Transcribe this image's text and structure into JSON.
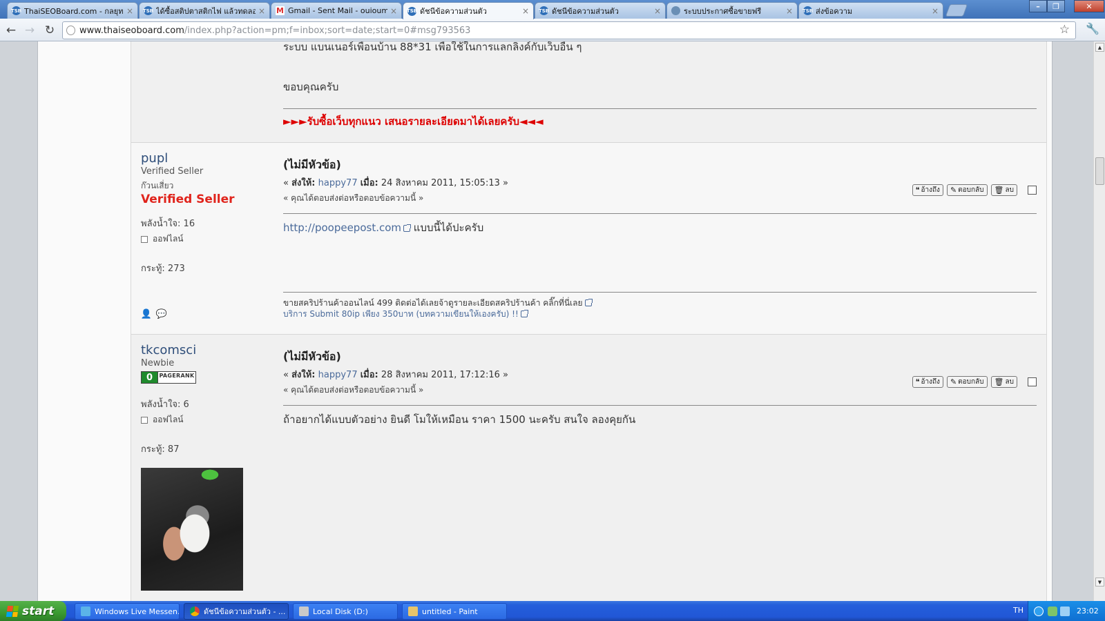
{
  "browser": {
    "tabs": [
      {
        "label": "ThaiSEOBoard.com - กลยุทธ S",
        "icon": "tsb-favicon",
        "active": false
      },
      {
        "label": "ได้ซื้อสติปตาสติกไฟ แล้วทดลอ",
        "icon": "tsb-favicon",
        "active": false
      },
      {
        "label": "Gmail - Sent Mail - ouioum11@",
        "icon": "gmail-favicon",
        "active": false
      },
      {
        "label": "ดัชนีข้อความส่วนตัว",
        "icon": "tsb-favicon",
        "active": true
      },
      {
        "label": "ดัชนีข้อความส่วนตัว",
        "icon": "tsb-favicon",
        "active": false
      },
      {
        "label": "ระบบประกาศซื้อขายฟรี",
        "icon": "globe-favicon",
        "active": false
      },
      {
        "label": "ส่งข้อความ",
        "icon": "tsb-favicon",
        "active": false
      }
    ],
    "tab_close_glyph": "×",
    "url_host": "www.thaiseoboard.com",
    "url_path": "/index.php?action=pm;f=inbox;sort=date;start=0#msg793563"
  },
  "top_post": {
    "line1": "ระบบ แบนเนอร์เพื่อนบ้าน 88*31 เพื่อใช้ในการแลกลิงค์กับเว็บอื่น ๆ",
    "line2": "ขอบคุณครับ",
    "signature": "►►►รับซื้อเว็บทุกแนว เสนอรายละเอียดมาได้เลยครับ◄◄◄"
  },
  "actions": {
    "quote": "อ้างถึง",
    "reply": "ตอบกลับ",
    "delete": "ลบ"
  },
  "posts": [
    {
      "name": "pupl",
      "rank": "Verified Seller",
      "group_small": "ก๊วนเสี่ยว",
      "group_big": "Verified Seller",
      "karma": "พลังน้ำใจ: 16",
      "status": "ออฟไลน์",
      "posts": "กระทู้: 273",
      "subject": "(ไม่มีหัวข้อ)",
      "to_label": "ส่งให้:",
      "to_user": "happy77",
      "when_label": "เมื่อ:",
      "when": "24 สิงหาคม 2011, 15:05:13",
      "replied": "คุณได้ตอบส่งต่อหรือตอบข้อความนี้",
      "message_url": "http://poopeepost.com",
      "message_text": " แบบนี้ได้ปะครับ",
      "sig1": "ขายสคริปร้านค้าออนไลน์ 499 ติดต่อได้เลยจ้าดูรายละเอียดสคริปร้านค้า คลิ๊กที่นี่เลย",
      "sig2": "บริการ Submit 80ip เพียง 350บาท (บทความเขียนให้เองครับ) !!"
    },
    {
      "name": "tkcomsci",
      "rank": "Newbie",
      "pagerank_value": "0",
      "pagerank_label": "PAGERANK",
      "karma": "พลังน้ำใจ: 6",
      "status": "ออฟไลน์",
      "posts": "กระทู้: 87",
      "subject": "(ไม่มีหัวข้อ)",
      "to_label": "ส่งให้:",
      "to_user": "happy77",
      "when_label": "เมื่อ:",
      "when": "28 สิงหาคม 2011, 17:12:16",
      "replied": "คุณได้ตอบส่งต่อหรือตอบข้อความนี้",
      "message_text": "ถ้าอยากได้แบบตัวอย่าง ยินดี โมให้เหมือน ราคา 1500 นะครับ สนใจ ลองคุยกัน"
    }
  ],
  "taskbar": {
    "start": "start",
    "items": [
      {
        "label": "Windows Live Messen...",
        "icon": "messenger-icon",
        "active": false
      },
      {
        "label": "ดัชนีข้อความส่วนตัว - ...",
        "icon": "chrome-icon",
        "active": true
      },
      {
        "label": "Local Disk (D:)",
        "icon": "drive-icon",
        "active": false
      },
      {
        "label": "untitled - Paint",
        "icon": "paint-icon",
        "active": false
      }
    ],
    "lang": "TH",
    "clock": "23:02"
  }
}
